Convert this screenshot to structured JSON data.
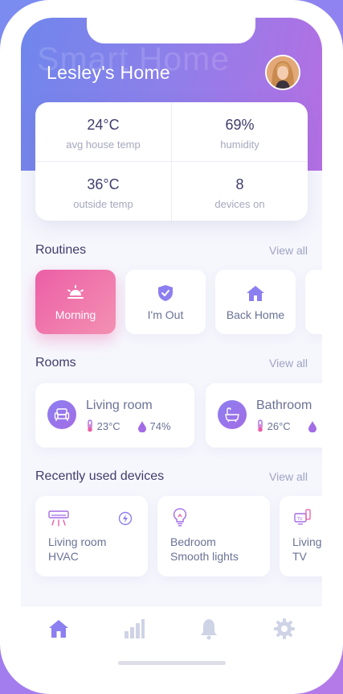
{
  "header": {
    "watermark": "Smart Home",
    "title": "Lesley's Home",
    "avatar_icon": "user-avatar"
  },
  "stats": [
    {
      "value": "24°C",
      "label": "avg house temp"
    },
    {
      "value": "69%",
      "label": "humidity"
    },
    {
      "value": "36°C",
      "label": "outside temp"
    },
    {
      "value": "8",
      "label": "devices on"
    }
  ],
  "routines": {
    "title": "Routines",
    "view_all": "View all",
    "items": [
      {
        "label": "Morning",
        "icon": "sunrise-icon",
        "active": true
      },
      {
        "label": "I'm Out",
        "icon": "shield-check-icon",
        "active": false
      },
      {
        "label": "Back Home",
        "icon": "house-icon",
        "active": false
      }
    ]
  },
  "rooms": {
    "title": "Rooms",
    "view_all": "View all",
    "items": [
      {
        "name": "Living room",
        "temp": "23°C",
        "humidity": "74%",
        "icon": "sofa-icon"
      },
      {
        "name": "Bathroom",
        "temp": "26°C",
        "humidity": "",
        "icon": "bathtub-icon"
      }
    ]
  },
  "devices": {
    "title": "Recently used devices",
    "view_all": "View all",
    "items": [
      {
        "line1": "Living room",
        "line2": "HVAC",
        "icon": "air-conditioner-icon"
      },
      {
        "line1": "Bedroom",
        "line2": "Smooth lights",
        "icon": "light-bulb-icon"
      },
      {
        "line1": "Living",
        "line2": "TV",
        "icon": "tv-remote-icon"
      }
    ]
  },
  "tabbar": {
    "items": [
      "home-icon",
      "stats-icon",
      "bell-icon",
      "gear-icon"
    ],
    "active": "home-icon"
  },
  "colors": {
    "accent": "#8c7ff0",
    "pink": "#ec5ea6",
    "text": "#3f3d6b",
    "muted": "#9ea4c2"
  }
}
